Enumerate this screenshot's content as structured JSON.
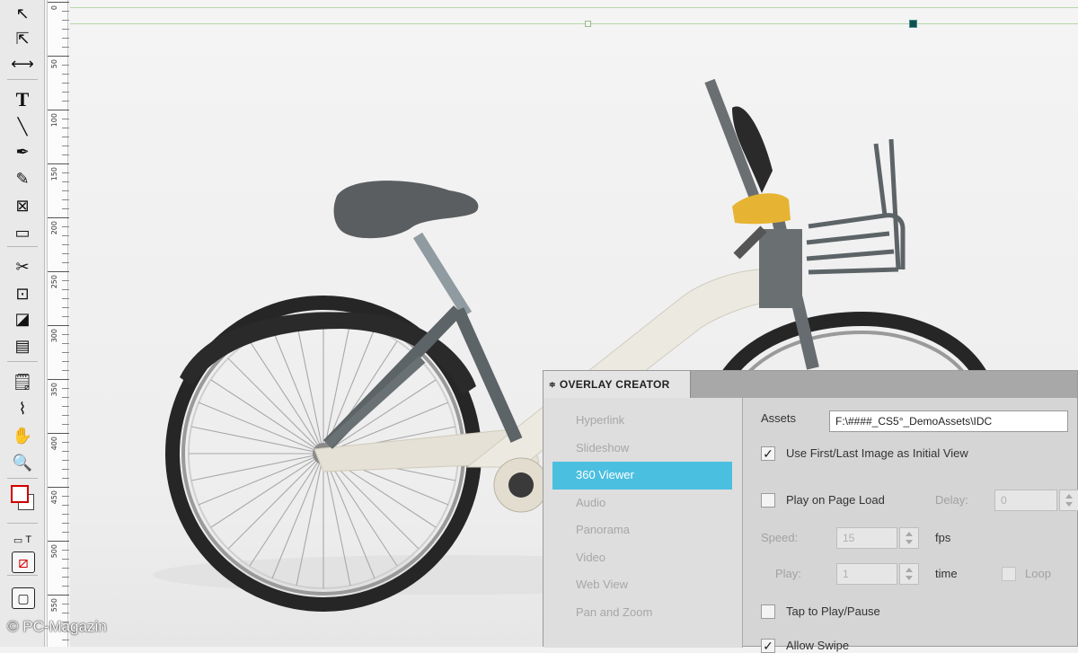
{
  "watermark": "© PC-Magazin",
  "toolbox": {
    "tools": [
      {
        "name": "selection-tool",
        "icon": "arrow-pointer-icon",
        "glyph": "↖"
      },
      {
        "name": "direct-selection-tool",
        "icon": "hollow-arrow-icon",
        "glyph": "⇱"
      },
      {
        "name": "gap-tool",
        "icon": "gap-icon",
        "glyph": "⟷"
      },
      {
        "name": "type-tool",
        "icon": "type-icon",
        "glyph": "T"
      },
      {
        "name": "line-tool",
        "icon": "line-icon",
        "glyph": "╲"
      },
      {
        "name": "pen-tool",
        "icon": "pen-icon",
        "glyph": "✒"
      },
      {
        "name": "pencil-tool",
        "icon": "pencil-icon",
        "glyph": "✎"
      },
      {
        "name": "rectangle-frame-tool",
        "icon": "frame-x-icon",
        "glyph": "⊠"
      },
      {
        "name": "rectangle-tool",
        "icon": "rectangle-icon",
        "glyph": "▭"
      },
      {
        "name": "scissors-tool",
        "icon": "scissors-icon",
        "glyph": "✂"
      },
      {
        "name": "free-transform-tool",
        "icon": "transform-icon",
        "glyph": "⊡"
      },
      {
        "name": "gradient-swatch-tool",
        "icon": "gradient-icon",
        "glyph": "◪"
      },
      {
        "name": "gradient-feather-tool",
        "icon": "feather-icon",
        "glyph": "▤"
      },
      {
        "name": "note-tool",
        "icon": "note-icon",
        "glyph": "🗒"
      },
      {
        "name": "eyedropper-tool",
        "icon": "eyedropper-icon",
        "glyph": "⌇"
      },
      {
        "name": "hand-tool",
        "icon": "hand-icon",
        "glyph": "✋"
      },
      {
        "name": "zoom-tool",
        "icon": "zoom-icon",
        "glyph": "🔍"
      }
    ],
    "swatch_label": "T",
    "colors": {
      "stroke": "#d00000",
      "fill": "#ffffff"
    }
  },
  "ruler": {
    "labels": [
      "0",
      "50",
      "100",
      "150",
      "200",
      "250",
      "300",
      "350",
      "400",
      "450",
      "500",
      "550"
    ]
  },
  "panel": {
    "title": "OVERLAY CREATOR",
    "collapse_glyph": "≑",
    "overlays": [
      {
        "label": "Hyperlink",
        "selected": false
      },
      {
        "label": "Slideshow",
        "selected": false
      },
      {
        "label": "360 Viewer",
        "selected": true
      },
      {
        "label": "Audio",
        "selected": false
      },
      {
        "label": "Panorama",
        "selected": false
      },
      {
        "label": "Video",
        "selected": false
      },
      {
        "label": "Web View",
        "selected": false
      },
      {
        "label": "Pan and Zoom",
        "selected": false
      }
    ],
    "settings": {
      "assets_label": "Assets",
      "assets_value": "F:\\####_CS5°_DemoAssets\\IDC",
      "use_first_last_label": "Use First/Last Image as Initial View",
      "use_first_last_checked": true,
      "play_on_load_label": "Play on Page Load",
      "play_on_load_checked": false,
      "delay_label": "Delay:",
      "delay_value": "0",
      "speed_label": "Speed:",
      "speed_value": "15",
      "speed_unit": "fps",
      "play_label": "Play:",
      "play_value": "1",
      "play_unit": "time",
      "loop_label": "Loop",
      "loop_checked": false,
      "tap_label": "Tap to Play/Pause",
      "tap_checked": false,
      "allow_swipe_label": "Allow Swipe",
      "allow_swipe_checked": true
    }
  },
  "colors": {
    "selection": "#4bbfe0",
    "guide": "#b6d6a8",
    "handle_dark": "#0e4f52",
    "bike_frame": "#e8e4da",
    "tire": "#262626",
    "accent_yellow": "#e6b432"
  }
}
